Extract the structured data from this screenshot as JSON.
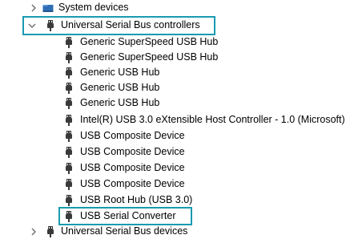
{
  "tree": {
    "system_devices": {
      "label": "System devices",
      "icon": "folder-device-icon",
      "expanded": false
    },
    "usb_controllers": {
      "label": "Universal Serial Bus controllers",
      "icon": "usb-plug-icon",
      "expanded": true,
      "children": [
        {
          "label": "Generic SuperSpeed USB Hub"
        },
        {
          "label": "Generic SuperSpeed USB Hub"
        },
        {
          "label": "Generic USB Hub"
        },
        {
          "label": "Generic USB Hub"
        },
        {
          "label": "Generic USB Hub"
        },
        {
          "label": "Intel(R) USB 3.0 eXtensible Host Controller - 1.0 (Microsoft)"
        },
        {
          "label": "USB Composite Device"
        },
        {
          "label": "USB Composite Device"
        },
        {
          "label": "USB Composite Device"
        },
        {
          "label": "USB Composite Device"
        },
        {
          "label": "USB Root Hub (USB 3.0)"
        },
        {
          "label": "USB Serial Converter"
        }
      ]
    },
    "usb_devices": {
      "label": "Universal Serial Bus devices",
      "icon": "usb-plug-icon",
      "expanded": false
    }
  },
  "colors": {
    "highlight_border": "#1a9bb0",
    "icon_dark": "#3a3a3a",
    "chevron": "#6d6d6d"
  }
}
